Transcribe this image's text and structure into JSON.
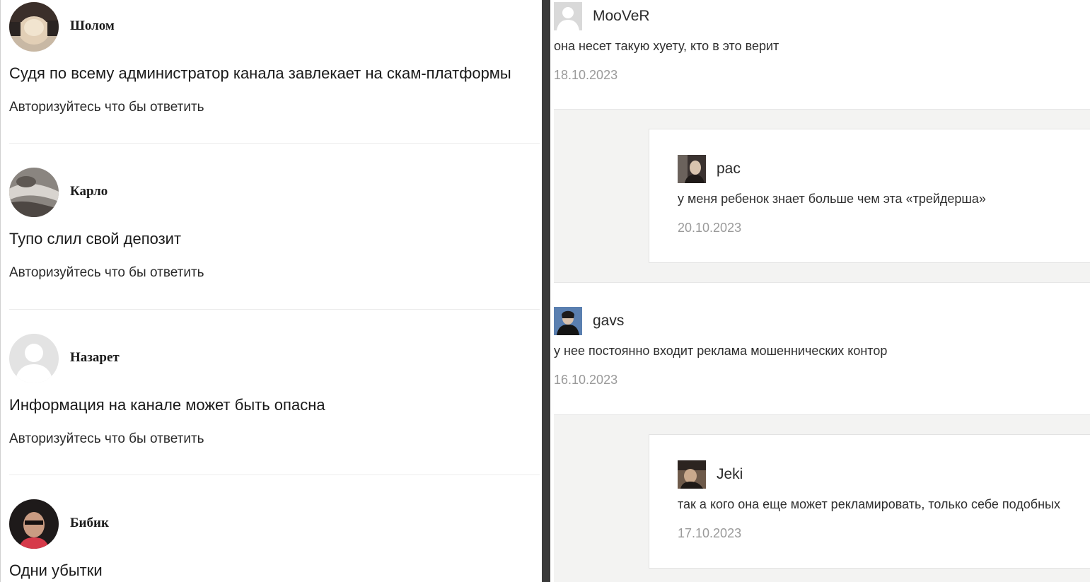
{
  "left_comments": [
    {
      "author": "Шолом",
      "text": "Судя по всему администратор канала завлекает на скам-платформы",
      "reply_link": "Авторизуйтесь что бы ответить",
      "avatar_icon": "photo-avatar-icon"
    },
    {
      "author": "Карло",
      "text": "Тупо слил свой депозит",
      "reply_link": "Авторизуйтесь что бы ответить",
      "avatar_icon": "photo-avatar-icon"
    },
    {
      "author": "Назарет",
      "text": "Информация на канале может быть опасна",
      "reply_link": "Авторизуйтесь что бы ответить",
      "avatar_icon": "default-user-avatar-icon"
    },
    {
      "author": "Бибик",
      "text": "Одни убытки",
      "avatar_icon": "photo-avatar-icon"
    }
  ],
  "right_comments": [
    {
      "author": "MooVeR",
      "text": "она несет такую хуету, кто в это верит",
      "date": "18.10.2023",
      "avatar_icon": "default-user-avatar-icon",
      "reply": {
        "author": "рас",
        "text": "у меня ребенок знает больше чем эта «трейдерша»",
        "date": "20.10.2023",
        "avatar_icon": "photo-avatar-icon"
      }
    },
    {
      "author": "gavs",
      "text": "у нее постоянно входит реклама мошеннических контор",
      "date": "16.10.2023",
      "avatar_icon": "photo-avatar-icon",
      "reply": {
        "author": "Jeki",
        "text": "так а кого она еще может рекламировать, только себе подобных",
        "date": "17.10.2023",
        "avatar_icon": "photo-avatar-icon"
      }
    }
  ],
  "colors": {
    "text": "#1a1a1a",
    "date": "#9a9a9a",
    "thread_bg": "#f3f3f2",
    "center_bar": "#3a3a3a"
  }
}
